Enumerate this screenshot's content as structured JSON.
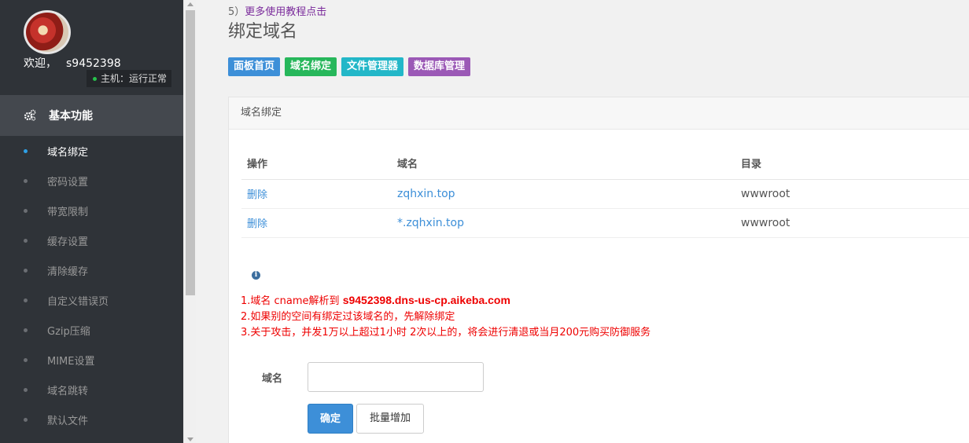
{
  "sidebar": {
    "welcome": "欢迎，",
    "username": "s9452398",
    "host_status": "主机：运行正常",
    "section_title": "基本功能",
    "items": [
      {
        "label": "域名绑定",
        "active": true
      },
      {
        "label": "密码设置"
      },
      {
        "label": "带宽限制"
      },
      {
        "label": "缓存设置"
      },
      {
        "label": "清除缓存"
      },
      {
        "label": "自定义错误页"
      },
      {
        "label": "Gzip压缩"
      },
      {
        "label": "MIME设置"
      },
      {
        "label": "域名跳转"
      },
      {
        "label": "默认文件"
      }
    ]
  },
  "main": {
    "breadcrumb_prefix": "5）",
    "breadcrumb_link": "更多使用教程点击",
    "page_title": "绑定域名",
    "buttons": [
      "面板首页",
      "域名绑定",
      "文件管理器",
      "数据库管理"
    ],
    "panel_title": "域名绑定",
    "table": {
      "headers": [
        "操作",
        "域名",
        "目录"
      ],
      "rows": [
        [
          "删除",
          "zqhxin.top",
          "wwwroot"
        ],
        [
          "删除",
          "*.zqhxin.top",
          "wwwroot"
        ]
      ]
    },
    "info_icon": "i",
    "notes": {
      "line1_prefix": "1.域名 cname解析到 ",
      "line1_bold": "s9452398.dns-us-cp.aikeba.com",
      "line2": "2.如果别的空间有绑定过该域名的，先解除绑定",
      "line3": "3.关于攻击，并发1万以上超过1小时 2次以上的，将会进行清退或当月200元购买防御服务"
    },
    "form": {
      "label": "域名",
      "input_value": "",
      "confirm_label": "确定",
      "batch_label": "批量增加"
    }
  },
  "colors": {
    "sidebar_bg": "#2f3338",
    "accent_blue": "#3d8fd8",
    "green": "#27b75b",
    "cyan": "#23b7c8",
    "purple": "#9b59b6",
    "notice_red": "#e00000"
  }
}
